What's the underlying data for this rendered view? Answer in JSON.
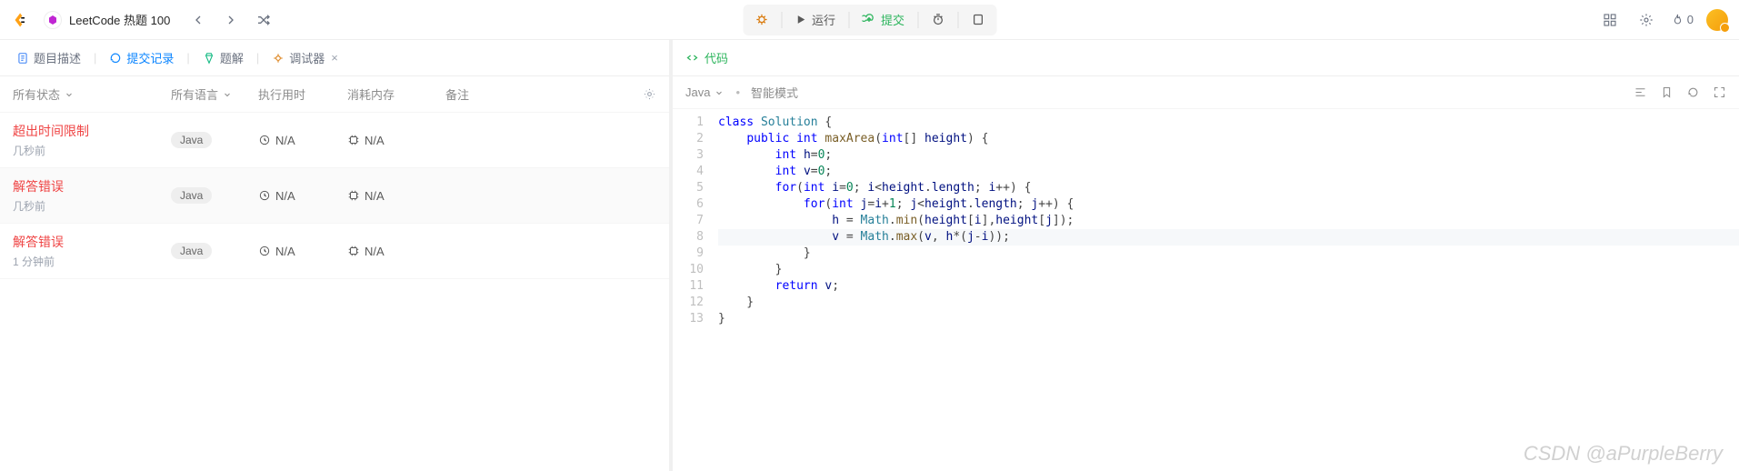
{
  "header": {
    "list_title": "LeetCode 热题 100",
    "run_label": "运行",
    "submit_label": "提交",
    "streak_count": "0"
  },
  "left": {
    "tabs": {
      "desc": "题目描述",
      "history": "提交记录",
      "solution": "题解",
      "debugger": "调试器"
    },
    "filters": {
      "status": "所有状态",
      "lang": "所有语言",
      "time": "执行用时",
      "mem": "消耗内存",
      "note": "备注"
    },
    "submissions": [
      {
        "status": "超出时间限制",
        "when": "几秒前",
        "lang": "Java",
        "time": "N/A",
        "mem": "N/A"
      },
      {
        "status": "解答错误",
        "when": "几秒前",
        "lang": "Java",
        "time": "N/A",
        "mem": "N/A"
      },
      {
        "status": "解答错误",
        "when": "1 分钟前",
        "lang": "Java",
        "time": "N/A",
        "mem": "N/A"
      }
    ]
  },
  "right": {
    "title": "代码",
    "language": "Java",
    "mode": "智能模式",
    "highlighted_line": 8,
    "code_lines": [
      [
        [
          "k",
          "class"
        ],
        [
          "p",
          " "
        ],
        [
          "t",
          "Solution"
        ],
        [
          "p",
          " {"
        ]
      ],
      [
        [
          "p",
          "    "
        ],
        [
          "k",
          "public"
        ],
        [
          "p",
          " "
        ],
        [
          "k",
          "int"
        ],
        [
          "p",
          " "
        ],
        [
          "fn",
          "maxArea"
        ],
        [
          "p",
          "("
        ],
        [
          "k",
          "int"
        ],
        [
          "p",
          "[] "
        ],
        [
          "v",
          "height"
        ],
        [
          "p",
          ") {"
        ]
      ],
      [
        [
          "p",
          "        "
        ],
        [
          "k",
          "int"
        ],
        [
          "p",
          " "
        ],
        [
          "v",
          "h"
        ],
        [
          "p",
          "="
        ],
        [
          "n",
          "0"
        ],
        [
          "p",
          ";"
        ]
      ],
      [
        [
          "p",
          "        "
        ],
        [
          "k",
          "int"
        ],
        [
          "p",
          " "
        ],
        [
          "v",
          "v"
        ],
        [
          "p",
          "="
        ],
        [
          "n",
          "0"
        ],
        [
          "p",
          ";"
        ]
      ],
      [
        [
          "p",
          "        "
        ],
        [
          "k",
          "for"
        ],
        [
          "p",
          "("
        ],
        [
          "k",
          "int"
        ],
        [
          "p",
          " "
        ],
        [
          "v",
          "i"
        ],
        [
          "p",
          "="
        ],
        [
          "n",
          "0"
        ],
        [
          "p",
          "; "
        ],
        [
          "v",
          "i"
        ],
        [
          "p",
          "<"
        ],
        [
          "v",
          "height"
        ],
        [
          "p",
          "."
        ],
        [
          "v",
          "length"
        ],
        [
          "p",
          "; "
        ],
        [
          "v",
          "i"
        ],
        [
          "p",
          "++) {"
        ]
      ],
      [
        [
          "p",
          "            "
        ],
        [
          "k",
          "for"
        ],
        [
          "p",
          "("
        ],
        [
          "k",
          "int"
        ],
        [
          "p",
          " "
        ],
        [
          "v",
          "j"
        ],
        [
          "p",
          "="
        ],
        [
          "v",
          "i"
        ],
        [
          "p",
          "+"
        ],
        [
          "n",
          "1"
        ],
        [
          "p",
          "; "
        ],
        [
          "v",
          "j"
        ],
        [
          "p",
          "<"
        ],
        [
          "v",
          "height"
        ],
        [
          "p",
          "."
        ],
        [
          "v",
          "length"
        ],
        [
          "p",
          "; "
        ],
        [
          "v",
          "j"
        ],
        [
          "p",
          "++) {"
        ]
      ],
      [
        [
          "p",
          "                "
        ],
        [
          "v",
          "h"
        ],
        [
          "p",
          " = "
        ],
        [
          "t",
          "Math"
        ],
        [
          "p",
          "."
        ],
        [
          "fn",
          "min"
        ],
        [
          "p",
          "("
        ],
        [
          "v",
          "height"
        ],
        [
          "p",
          "["
        ],
        [
          "v",
          "i"
        ],
        [
          "p",
          "],"
        ],
        [
          "v",
          "height"
        ],
        [
          "p",
          "["
        ],
        [
          "v",
          "j"
        ],
        [
          "p",
          "]);"
        ]
      ],
      [
        [
          "p",
          "                "
        ],
        [
          "v",
          "v"
        ],
        [
          "p",
          " = "
        ],
        [
          "t",
          "Math"
        ],
        [
          "p",
          "."
        ],
        [
          "fn",
          "max"
        ],
        [
          "p",
          "("
        ],
        [
          "v",
          "v"
        ],
        [
          "p",
          ", "
        ],
        [
          "v",
          "h"
        ],
        [
          "p",
          "*("
        ],
        [
          "v",
          "j"
        ],
        [
          "p",
          "-"
        ],
        [
          "v",
          "i"
        ],
        [
          "p",
          "));"
        ]
      ],
      [
        [
          "p",
          "            }"
        ]
      ],
      [
        [
          "p",
          "        }"
        ]
      ],
      [
        [
          "p",
          "        "
        ],
        [
          "k",
          "return"
        ],
        [
          "p",
          " "
        ],
        [
          "v",
          "v"
        ],
        [
          "p",
          ";"
        ]
      ],
      [
        [
          "p",
          "    }"
        ]
      ],
      [
        [
          "p",
          "}"
        ]
      ]
    ]
  },
  "watermark": "CSDN @aPurpleBerry"
}
